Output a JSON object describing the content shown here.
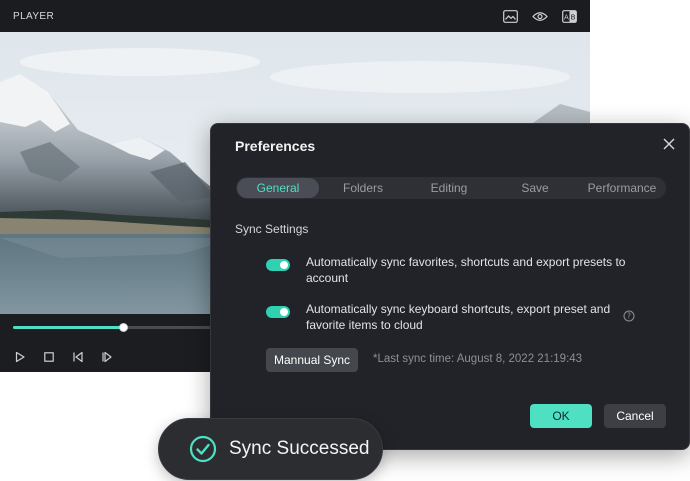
{
  "player": {
    "title": "PLAYER",
    "toolbar_icons": [
      "image-icon",
      "eye-icon",
      "ab-compare-icon"
    ],
    "playback_progress": 0.55,
    "controls": [
      "play-icon",
      "stop-icon",
      "previous-frame-icon",
      "next-frame-icon"
    ]
  },
  "preferences": {
    "title": "Preferences",
    "tabs": [
      {
        "label": "General",
        "active": true
      },
      {
        "label": "Folders",
        "active": false
      },
      {
        "label": "Editing",
        "active": false
      },
      {
        "label": "Save",
        "active": false
      },
      {
        "label": "Performance",
        "active": false
      }
    ],
    "section_label": "Sync Settings",
    "sync_options": [
      {
        "text": "Automatically sync favorites, shortcuts and export presets to account",
        "enabled": true
      },
      {
        "text": "Automatically sync keyboard shortcuts, export preset and favorite items to cloud",
        "enabled": true
      }
    ],
    "manual_sync_label": "Mannual Sync",
    "last_sync_text": "*Last sync time: August 8, 2022 21:19:43",
    "ok_label": "OK",
    "cancel_label": "Cancel"
  },
  "toast": {
    "text": "Sync Successed"
  },
  "colors": {
    "accent": "#4fe0c4",
    "dialog_bg": "#222328",
    "player_bg": "#1c1d20",
    "toast_bg": "#2c2d31"
  }
}
